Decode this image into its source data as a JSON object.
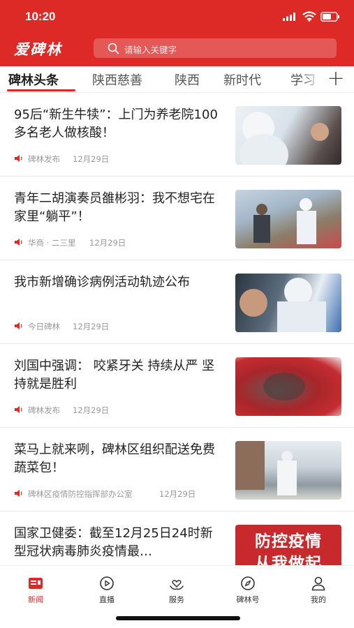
{
  "status_bar": {
    "time": "10:20"
  },
  "header": {
    "logo_text": "爱碑林",
    "search_placeholder": "请输入关键字",
    "brand_color": "#dd2a27"
  },
  "tabs": [
    {
      "label": "碑林头条",
      "active": true
    },
    {
      "label": "陕西慈善",
      "active": false
    },
    {
      "label": "陕西",
      "active": false
    },
    {
      "label": "新时代",
      "active": false
    },
    {
      "label": "学习",
      "active": false
    }
  ],
  "add_tab_label": "+",
  "news": [
    {
      "title": "95后“新生牛犊”：上门为养老院100多名老人做核酸！",
      "source": "碑林发布",
      "date": "12月29日"
    },
    {
      "title": "青年二胡演奏员雒彬羽：我不想宅在家里“躺平”！",
      "source": "华商 · 二三里",
      "date": "12月29日"
    },
    {
      "title": "我市新增确诊病例活动轨迹公布",
      "source": "今日碑林",
      "date": "12月29日"
    },
    {
      "title": "刘国中强调： 咬紧牙关 持续从严 坚持就是胜利",
      "source": "碑林发布",
      "date": "12月29日"
    },
    {
      "title": "菜马上就来咧，碑林区组织配送免费蔬菜包！",
      "source": "碑林区疫情防控指挥部办公室",
      "date": "12月29日"
    },
    {
      "title": "国家卫健委：截至12月25日24时新型冠状病毒肺炎疫情最…",
      "source": "",
      "date": "",
      "poster_line1": "防控疫情",
      "poster_line2": "从我做起"
    }
  ],
  "bottom_nav": [
    {
      "label": "新闻",
      "icon": "news-icon",
      "active": true
    },
    {
      "label": "直播",
      "icon": "live-icon",
      "active": false
    },
    {
      "label": "服务",
      "icon": "service-icon",
      "active": false
    },
    {
      "label": "碑林号",
      "icon": "compass-icon",
      "active": false
    },
    {
      "label": "我的",
      "icon": "profile-icon",
      "active": false
    }
  ]
}
